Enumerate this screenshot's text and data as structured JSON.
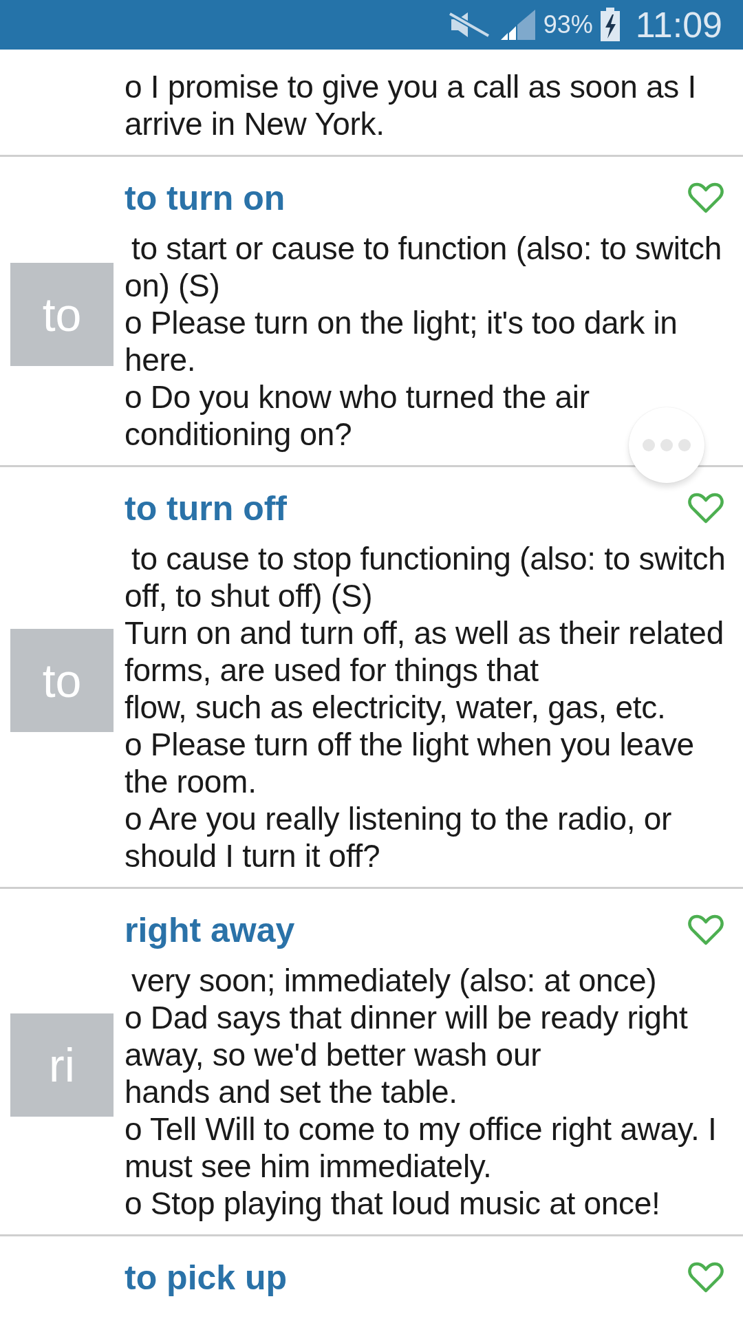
{
  "status_bar": {
    "battery": "93%",
    "time": "11:09"
  },
  "entries": [
    {
      "lines": [
        {
          "kind": "example",
          "text": "o I promise to give you a call as soon as I arrive in New York."
        }
      ]
    },
    {
      "thumb": "to",
      "title": "to turn on",
      "favorite": false,
      "lines": [
        {
          "kind": "definition",
          "text": "to start or cause to function (also: to switch on) (S)"
        },
        {
          "kind": "example",
          "text": "o Please turn on the light; it's too dark in here."
        },
        {
          "kind": "example",
          "text": "o Do you know who turned the air conditioning on?"
        }
      ]
    },
    {
      "thumb": "to",
      "title": "to turn off",
      "favorite": false,
      "lines": [
        {
          "kind": "definition",
          "text": "to cause to stop functioning (also: to switch off, to shut off) (S)"
        },
        {
          "kind": "example",
          "text": "Turn on and turn off, as well as their related forms, are used for things that"
        },
        {
          "kind": "example",
          "text": "flow, such as electricity, water, gas, etc."
        },
        {
          "kind": "example",
          "text": "o Please turn off the light when you leave the room."
        },
        {
          "kind": "example",
          "text": "o Are you really listening to the radio, or should I turn it off?"
        }
      ]
    },
    {
      "thumb": "ri",
      "title": "right away",
      "favorite": false,
      "lines": [
        {
          "kind": "definition",
          "text": "very soon; immediately (also: at once)"
        },
        {
          "kind": "example",
          "text": "o Dad says that dinner will be ready right away, so we'd better wash our"
        },
        {
          "kind": "example",
          "text": "hands and set the table."
        },
        {
          "kind": "example",
          "text": "o Tell Will to come to my office right away. I must see him immediately."
        },
        {
          "kind": "example",
          "text": "o Stop playing that loud music at once!"
        }
      ]
    },
    {
      "title": "to pick up",
      "favorite": false
    }
  ]
}
